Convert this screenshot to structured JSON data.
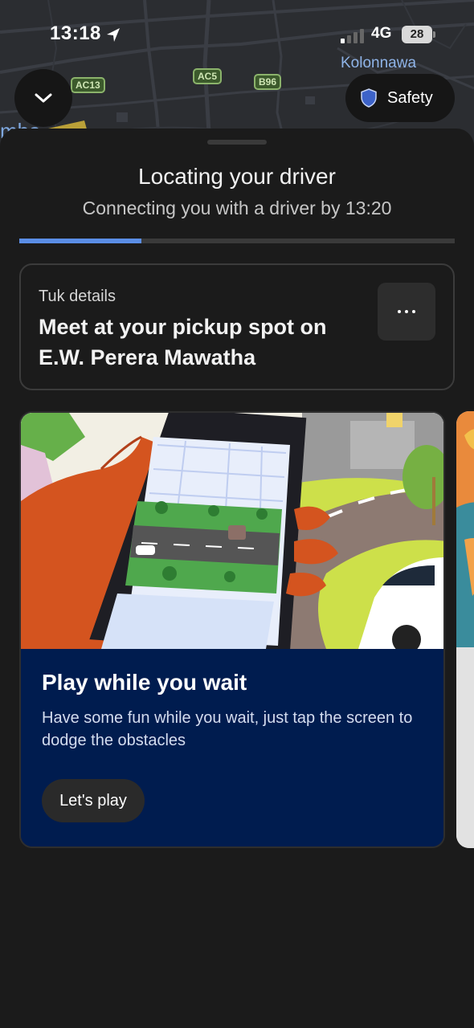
{
  "status_bar": {
    "time": "13:18",
    "network": "4G",
    "battery": "28",
    "location_icon": "location-arrow-icon"
  },
  "map": {
    "road_labels": [
      "AC13",
      "AC5",
      "B96"
    ],
    "place_label": "Kolonnawa",
    "partial_label": "mba"
  },
  "safety_button": {
    "label": "Safety",
    "icon": "shield-icon"
  },
  "collapse_button": {
    "icon": "chevron-down-icon"
  },
  "sheet": {
    "title": "Locating your driver",
    "subtitle": "Connecting you with a driver by 13:20",
    "progress_fraction": 0.28
  },
  "details_card": {
    "label": "Tuk details",
    "text": "Meet at your pickup spot on E.W. Perera Mawatha",
    "more_icon": "more-options-icon"
  },
  "promo_card": {
    "title": "Play while you wait",
    "description": "Have some fun while you wait, just tap the screen to dodge the obstacles",
    "button_label": "Let's play"
  },
  "colors": {
    "accent": "#5b8ee6",
    "sheet_bg": "#1b1b1b",
    "promo_bg": "#001c4f",
    "shield": "#3d63c9"
  }
}
